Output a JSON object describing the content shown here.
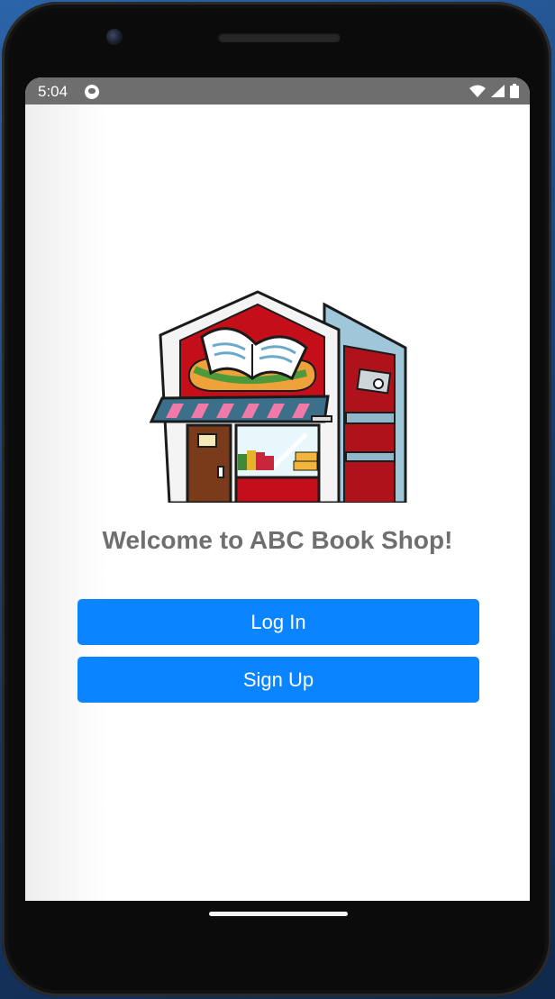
{
  "status_bar": {
    "time": "5:04",
    "icons": [
      "app-notification-icon",
      "wifi-icon",
      "cellular-signal-icon",
      "battery-icon"
    ]
  },
  "main": {
    "illustration": "bookshop-storefront-illustration",
    "welcome_text": "Welcome to ABC Book Shop!",
    "login_label": "Log In",
    "signup_label": "Sign Up"
  },
  "colors": {
    "primary_button": "#0a84ff",
    "welcome_text": "#6f6f6f",
    "status_bar": "#6e6e6e"
  }
}
